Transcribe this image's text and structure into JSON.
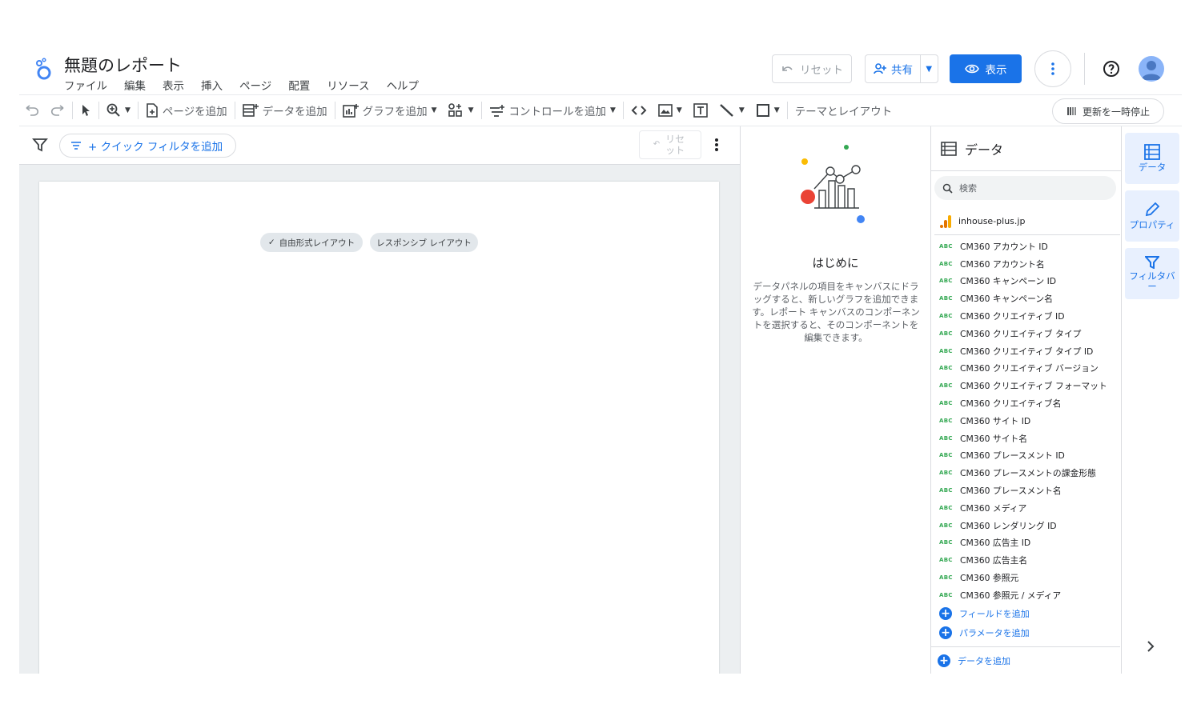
{
  "header": {
    "title": "無題のレポート",
    "menu": [
      "ファイル",
      "編集",
      "表示",
      "挿入",
      "ページ",
      "配置",
      "リソース",
      "ヘルプ"
    ],
    "reset_label": "リセット",
    "share_label": "共有",
    "view_label": "表示"
  },
  "toolbar": {
    "add_page": "ページを追加",
    "add_data": "データを追加",
    "add_chart": "グラフを追加",
    "add_control": "コントロールを追加",
    "theme_layout": "テーマとレイアウト",
    "pause_updates": "更新を一時停止"
  },
  "filterbar": {
    "quick_filter": "+ クイック フィルタを追加",
    "reset": "リセット"
  },
  "canvas": {
    "freeform_chip": "自由形式レイアウト",
    "responsive_chip": "レスポンシブ レイアウト"
  },
  "getting_started": {
    "title": "はじめに",
    "description": "データパネルの項目をキャンバスにドラッグすると、新しいグラフを追加できます。レポート キャンバスのコンポーネントを選択すると、そのコンポーネントを編集できます。"
  },
  "data_panel": {
    "title": "データ",
    "search_placeholder": "検索",
    "source": "inhouse-plus.jp",
    "field_type_label": "ABC",
    "fields": [
      "CM360 アカウント ID",
      "CM360 アカウント名",
      "CM360 キャンペーン ID",
      "CM360 キャンペーン名",
      "CM360 クリエイティブ ID",
      "CM360 クリエイティブ タイプ",
      "CM360 クリエイティブ タイプ ID",
      "CM360 クリエイティブ バージョン",
      "CM360 クリエイティブ フォーマット",
      "CM360 クリエイティブ名",
      "CM360 サイト ID",
      "CM360 サイト名",
      "CM360 プレースメント ID",
      "CM360 プレースメントの課金形態",
      "CM360 プレースメント名",
      "CM360 メディア",
      "CM360 レンダリング ID",
      "CM360 広告主 ID",
      "CM360 広告主名",
      "CM360 参照元",
      "CM360 参照元 / メディア"
    ],
    "add_field": "フィールドを追加",
    "add_parameter": "パラメータを追加",
    "add_data": "データを追加"
  },
  "rail": {
    "data": "データ",
    "properties": "プロパティ",
    "filter_bar": "フィルタバー"
  },
  "colors": {
    "accent": "#1a73e8",
    "field_type": "#34a853",
    "canvas_bg": "#eceff1"
  }
}
